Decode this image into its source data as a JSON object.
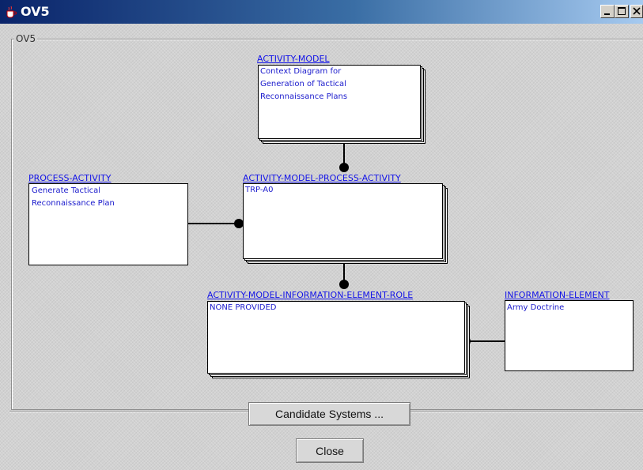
{
  "window": {
    "title": "OV5"
  },
  "group": {
    "label": "OV5"
  },
  "nodes": {
    "activity_model": {
      "title": "ACTIVITY-MODEL",
      "text": "Context Diagram for\nGeneration of Tactical\nReconnaissance Plans"
    },
    "process_activity": {
      "title": "PROCESS-ACTIVITY",
      "text": "Generate Tactical\nReconnaissance Plan"
    },
    "activity_model_process_activity": {
      "title": "ACTIVITY-MODEL-PROCESS-ACTIVITY",
      "text": "TRP-A0"
    },
    "activity_model_information_element_role": {
      "title": "ACTIVITY-MODEL-INFORMATION-ELEMENT-ROLE",
      "text": "NONE PROVIDED"
    },
    "information_element": {
      "title": "INFORMATION-ELEMENT",
      "text": "Army Doctrine"
    }
  },
  "buttons": {
    "candidate_systems": "Candidate Systems ...",
    "close": "Close"
  },
  "colors": {
    "link": "#1414e8",
    "title_bar": "#0a246a"
  }
}
